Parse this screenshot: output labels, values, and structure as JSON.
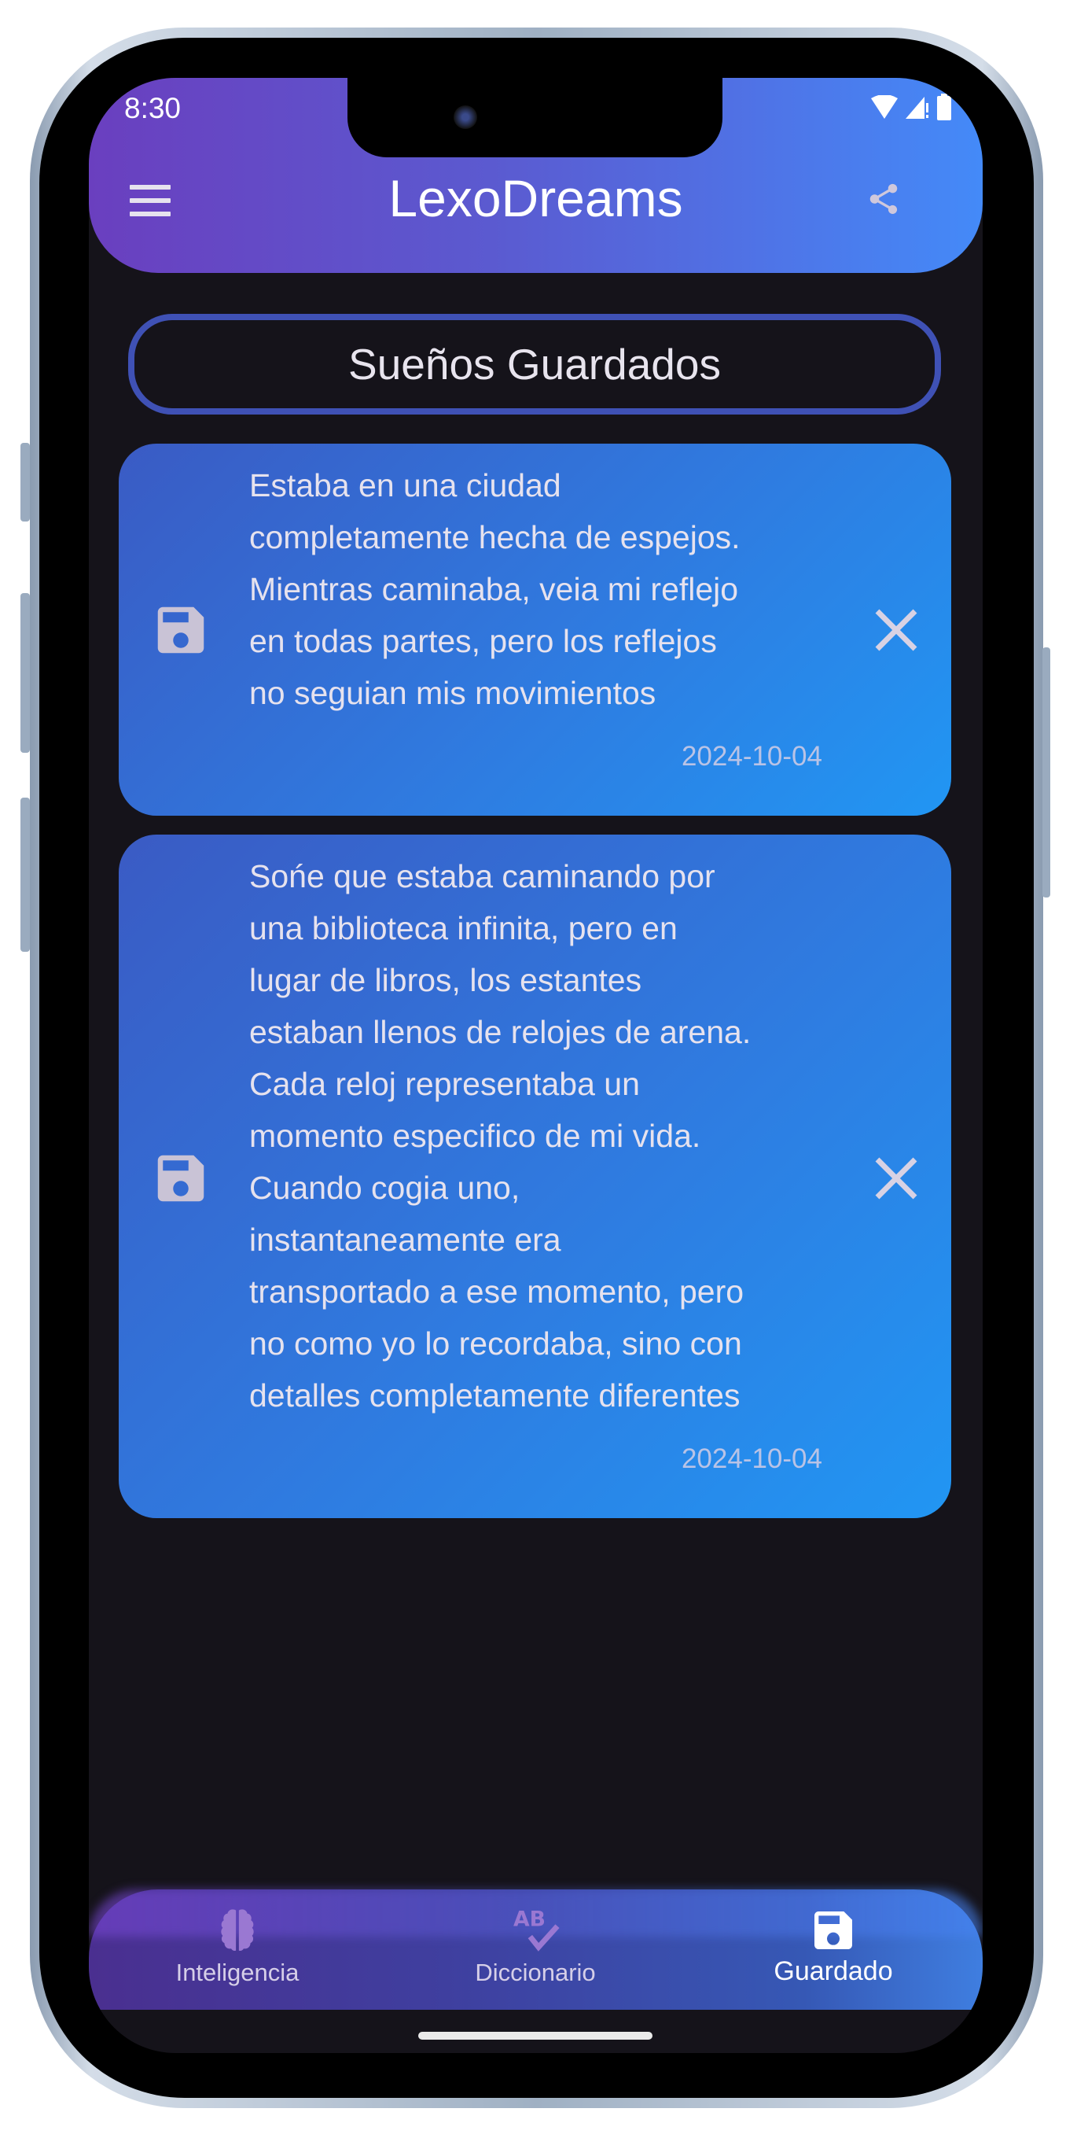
{
  "status_bar": {
    "time": "8:30"
  },
  "app_bar": {
    "title": "LexoDreams",
    "menu_icon": "hamburger-icon",
    "share_icon": "share-icon"
  },
  "section": {
    "title": "Sueños Guardados"
  },
  "dreams": [
    {
      "lines": [
        "Estaba en una ciudad",
        "completamente hecha de espejos.",
        "Mientras caminaba, veia mi reflejo",
        "en todas partes, pero los reflejos",
        "no seguian mis movimientos"
      ],
      "date": "2024-10-04"
    },
    {
      "lines": [
        "Sońe que estaba caminando por",
        "una biblioteca infinita, pero en",
        "lugar de libros, los estantes",
        "estaban llenos de relojes de arena.",
        "Cada reloj representaba un",
        "momento especifico de mi vida.",
        "Cuando cogia uno,",
        "instantaneamente era",
        "transportado a ese momento, pero",
        "no como yo lo recordaba, sino con",
        "detalles completamente diferentes"
      ],
      "date": "2024-10-04"
    }
  ],
  "bottom_nav": {
    "items": [
      {
        "label": "Inteligencia",
        "icon": "brain-icon"
      },
      {
        "label": "Diccionario",
        "icon": "spellcheck-icon"
      },
      {
        "label": "Guardado",
        "icon": "save-icon",
        "active": true
      }
    ]
  },
  "colors": {
    "accent": "#3f51b5",
    "card_end": "#2196f3",
    "background": "#15131a",
    "header_start": "#6a3fbf",
    "header_end": "#448af8"
  }
}
